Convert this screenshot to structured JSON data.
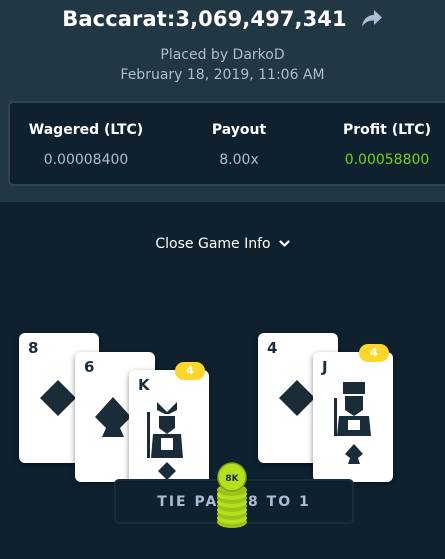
{
  "header": {
    "title": "Baccarat:3,069,497,341",
    "placed_by": "Placed by DarkoD",
    "date": "February 18, 2019, 11:06 AM"
  },
  "stats": [
    {
      "label": "Wagered (LTC)",
      "value": "0.00008400"
    },
    {
      "label": "Payout",
      "value": "8.00x"
    },
    {
      "label": "Profit (LTC)",
      "value": "0.00058800"
    }
  ],
  "toggle": {
    "label": "Close Game Info"
  },
  "player_hand": {
    "cards": [
      {
        "rank": "8",
        "suit": "diamond"
      },
      {
        "rank": "6",
        "suit": "spade"
      },
      {
        "rank": "K",
        "suit": "diamond"
      }
    ],
    "total": "4"
  },
  "banker_hand": {
    "cards": [
      {
        "rank": "4",
        "suit": "diamond"
      },
      {
        "rank": "J",
        "suit": "spade"
      }
    ],
    "total": "4"
  },
  "result_banner": {
    "text": "TIE PAYS 8 TO 1"
  },
  "chip_stack": {
    "label": "8K"
  },
  "colors": {
    "header_bg": "#213743",
    "page_bg": "#0f212e",
    "profit_green": "#76d11e",
    "badge_yellow": "#fed72a",
    "chip_green": "#b3e01f"
  }
}
